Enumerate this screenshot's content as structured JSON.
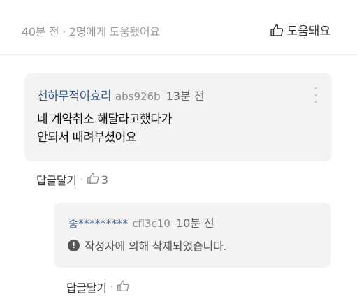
{
  "post_meta": {
    "meta_text": "40분 전 · 2명에게 도움됐어요",
    "helpful_label": "도움돼요"
  },
  "comment": {
    "author": "천하무적이효리",
    "user_id": "abs926b",
    "time": "13분 전",
    "body_lines": [
      "네 계약취소 해달라고했다가",
      "안되서 때려부셨어요"
    ],
    "reply_label": "답글달기",
    "separator": "·",
    "like_count": "3"
  },
  "reply": {
    "author": "송*********",
    "user_id": "cfl3c10",
    "time": "10분 전",
    "alert_glyph": "!",
    "deleted_message": "작성자에 의해 삭제되었습니다.",
    "reply_label": "답글달기",
    "separator": "·"
  },
  "colors": {
    "author": "#3e5c8a",
    "bubble_bg": "#f3f3f3",
    "meta_gray": "#9a9a9a"
  }
}
